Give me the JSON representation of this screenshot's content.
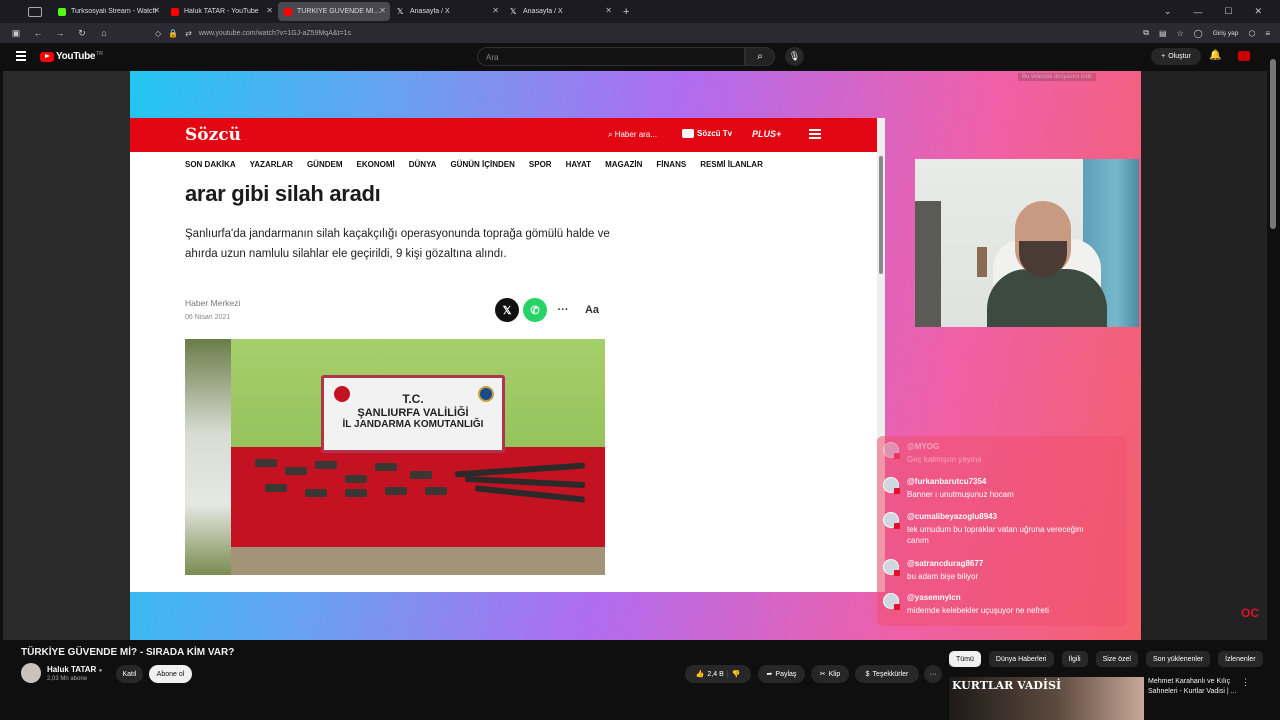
{
  "browser": {
    "tabs": [
      {
        "label": "Turksosyali Stream - Watch",
        "color": "#53fc18"
      },
      {
        "label": "Haluk TATAR - YouTube",
        "color": "#ff0000"
      },
      {
        "label": "TÜRKİYE GÜVENDE Mİ? - SIRAD",
        "color": "#ff0000"
      },
      {
        "label": "Anasayfa / X",
        "color": "#ffffff"
      },
      {
        "label": "Anasayfa / X",
        "color": "#ffffff"
      }
    ],
    "url": "www.youtube.com/watch?v=1GJ-aZ59MqA&t=1s",
    "signin": "Giriş yap"
  },
  "youtube": {
    "logo_text": "YouTube",
    "logo_country": "TR",
    "search_placeholder": "Ara",
    "create_label": "Oluştur",
    "video_info_note": "Bu videoda dosyasını indir",
    "video_title": "TÜRKİYE GÜVENDE Mİ? - SIRADA KİM VAR?",
    "channel_name": "Haluk TATAR",
    "channel_subs": "2,03 Mn abone",
    "join_label": "Katıl",
    "subscribe_label": "Abone ol",
    "like_count": "2,4 B",
    "share_label": "Paylaş",
    "clip_label": "Klip",
    "thanks_label": "Teşekkürler",
    "chips": [
      "Tümü",
      "Dünya Haberleri",
      "İlgili",
      "Size özel",
      "Son yüklenenler",
      "İzlenenler"
    ],
    "suggested": {
      "thumb_text": "KURTLAR VADİSİ",
      "title": "Mehmet Karahanlı ve Kılıç Sahneleri - Kurtlar Vadisi | ..."
    }
  },
  "article": {
    "logo": "Sözcü",
    "search_label": "Haber ara...",
    "tv_label": "Sözcü Tv",
    "plus_label": "PLUS+",
    "categories": [
      "SON DAKİKA",
      "YAZARLAR",
      "GÜNDEM",
      "EKONOMİ",
      "DÜNYA",
      "GÜNÜN İÇİNDEN",
      "SPOR",
      "HAYAT",
      "MAGAZİN",
      "FİNANS",
      "RESMİ İLANLAR"
    ],
    "title": "arar gibi silah aradı",
    "lead": "Şanlıurfa'da jandarmanın silah kaçakçılığı operasyonunda toprağa gömülü halde ve ahırda uzun namlulu silahlar ele geçirildi, 9 kişi gözaltına alındı.",
    "author": "Haber Merkezi",
    "date": "06 Nisan 2021",
    "photo_sign": {
      "line1": "T.C.",
      "line2": "ŞANLIURFA VALİLİĞİ",
      "line3": "İL JANDARMA KOMUTANLIĞI"
    }
  },
  "chat": [
    {
      "user": "@MYOG",
      "text": "Geç kalmışım yayına"
    },
    {
      "user": "@furkanbarutcu7354",
      "text": "Banner ı unutmuşunuz hocam"
    },
    {
      "user": "@cumalibeyazoglu8943",
      "text": "tek umudum bu topraklar vatan uğruna vereceğim canım"
    },
    {
      "user": "@satrancdurag8677",
      "text": "bu adam bişe biliyor"
    },
    {
      "user": "@yasemnylcn",
      "text": "midemde kelebekler uçuşuyor ne nefreti"
    }
  ],
  "overlay_brand": "OC"
}
